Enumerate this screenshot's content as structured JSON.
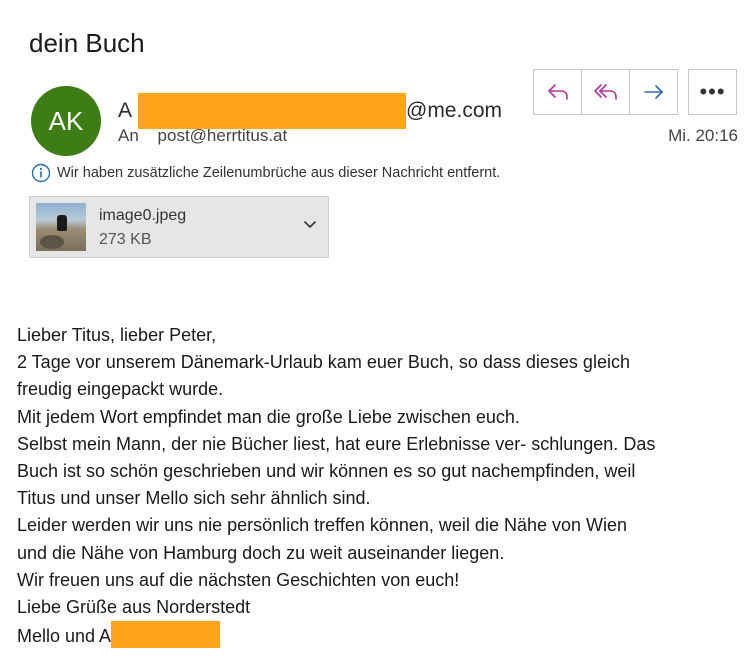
{
  "subject": "dein Buch",
  "sender": {
    "avatar_initials": "AK",
    "avatar_color": "#3e7d16",
    "name_prefix": "A",
    "email_domain": "@me.com",
    "redaction_color": "#ffa41b"
  },
  "recipient": {
    "label": "An",
    "address": "post@herrtitus.at"
  },
  "time": "Mi. 20:16",
  "actions": {
    "reply_icon": "reply-icon",
    "reply_all_icon": "reply-all-icon",
    "forward_icon": "forward-icon",
    "more_label": "•••",
    "reply_color": "#b4369e",
    "forward_color": "#2b6cb0"
  },
  "info_notice": "Wir haben zusätzliche Zeilenumbrüche aus dieser Nachricht entfernt.",
  "attachment": {
    "name": "image0.jpeg",
    "size": "273 KB"
  },
  "body_lines": [
    "Lieber Titus, lieber Peter,",
    "2 Tage vor unserem Dänemark-Urlaub kam euer Buch, so dass dieses gleich",
    "freudig eingepackt wurde.",
    "Mit jedem Wort empfindet man die große Liebe zwischen euch.",
    "Selbst mein Mann, der nie Bücher liest, hat eure Erlebnisse ver- schlungen. Das",
    "Buch ist so schön geschrieben und wir können es so gut nachempfinden, weil",
    "Titus und unser Mello sich sehr ähnlich sind.",
    "Leider werden wir uns nie persönlich treffen können, weil die Nähe von Wien",
    "und die Nähe von Hamburg doch zu weit auseinander liegen.",
    "Wir freuen uns auf die nächsten Geschichten von euch!",
    "Liebe Grüße aus Norderstedt"
  ],
  "signature_prefix": "Mello und A"
}
